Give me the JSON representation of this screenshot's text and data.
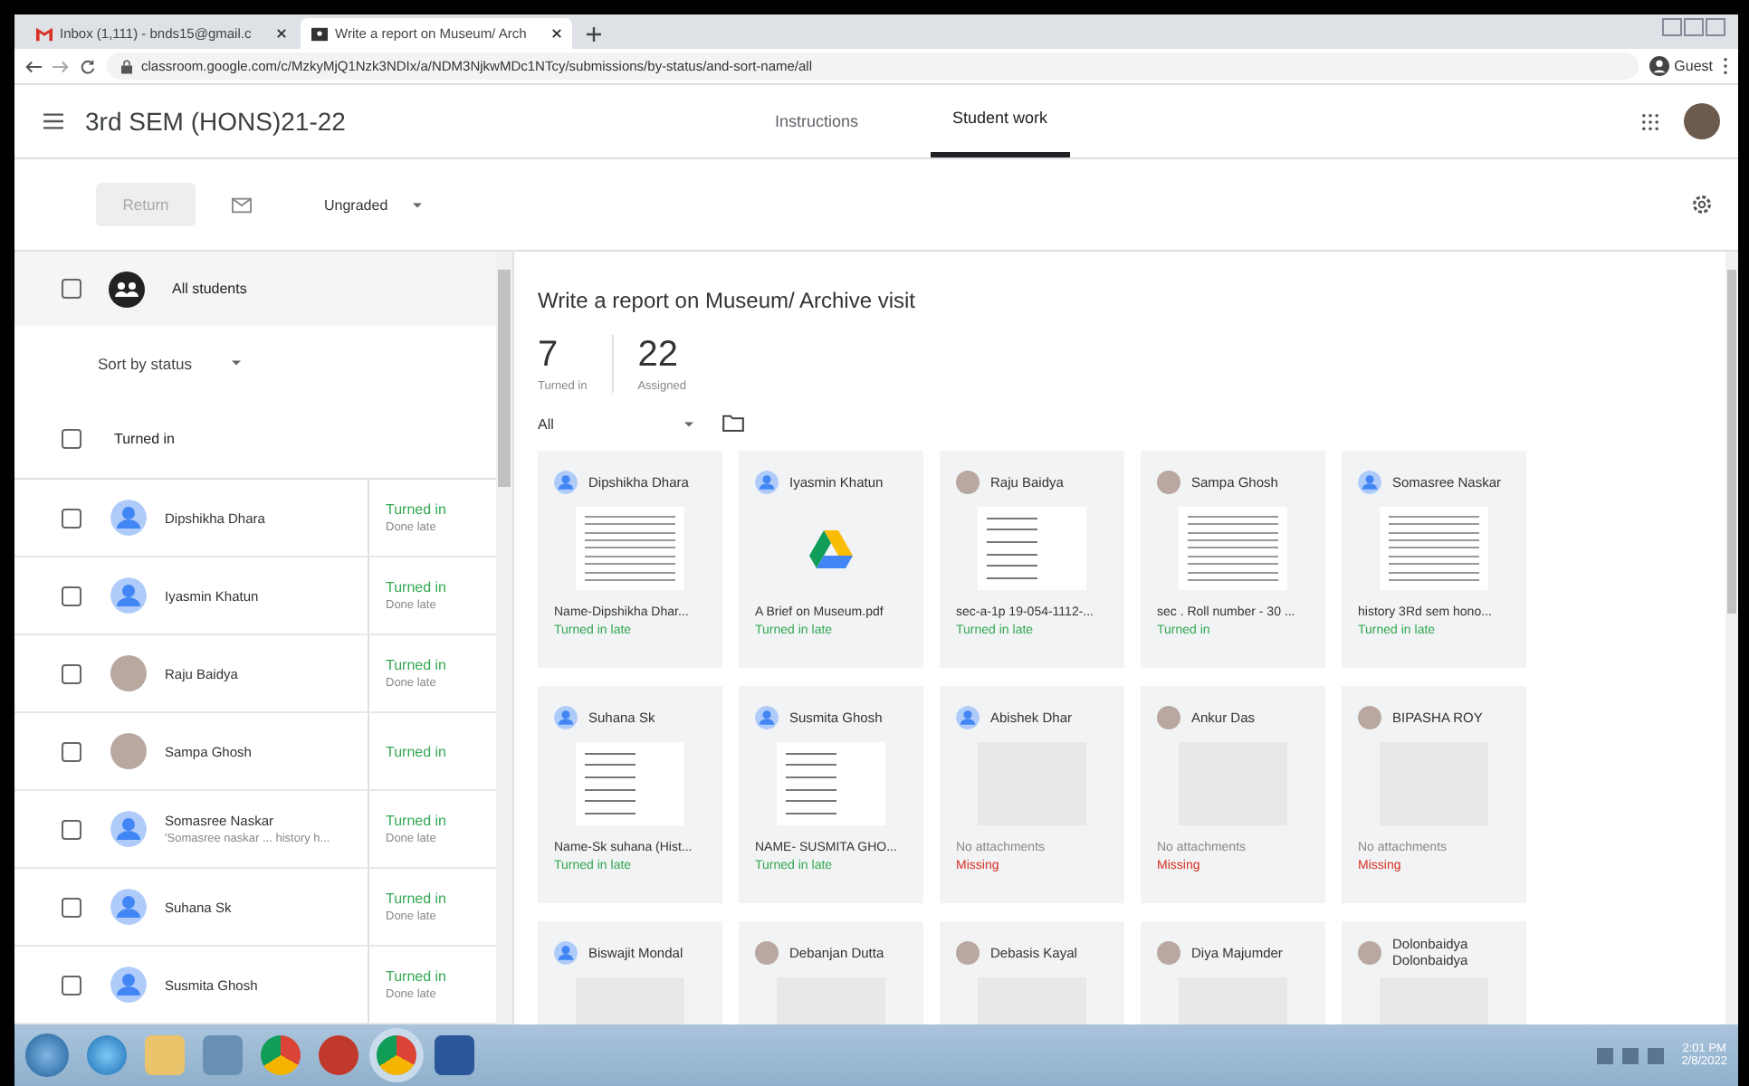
{
  "browser": {
    "tabs": [
      {
        "title": "Inbox (1,111) - bnds15@gmail.c",
        "selected": false
      },
      {
        "title": "Write a report on Museum/ Arch",
        "selected": true
      }
    ],
    "url": "classroom.google.com/c/MzkyMjQ1Nzk3NDIx/a/NDM3NjkwMDc1NTcy/submissions/by-status/and-sort-name/all",
    "profile": "Guest"
  },
  "header": {
    "course_title": "3rd SEM (HONS)21-22",
    "tabs": [
      {
        "label": "Instructions",
        "selected": false
      },
      {
        "label": "Student work",
        "selected": true
      }
    ]
  },
  "toolbar": {
    "return_button": {
      "label": "Return",
      "disabled": true
    },
    "grade_filter": "Ungraded"
  },
  "sidebar": {
    "all_students": {
      "label": "All students",
      "checked": false
    },
    "sort": "Sort by status",
    "group": {
      "label": "Turned in",
      "checked": false
    },
    "students": [
      {
        "name": "Dipshikha Dhara",
        "avatar": {
          "kind": "default"
        },
        "status": "Turned in",
        "note": "Done late",
        "checked": false
      },
      {
        "name": "Iyasmin Khatun",
        "avatar": {
          "kind": "default"
        },
        "status": "Turned in",
        "note": "Done late",
        "checked": false
      },
      {
        "name": "Raju Baidya",
        "avatar": {
          "kind": "photo"
        },
        "status": "Turned in",
        "note": "Done late",
        "checked": false
      },
      {
        "name": "Sampa Ghosh",
        "avatar": {
          "kind": "photo"
        },
        "status": "Turned in",
        "checked": false
      },
      {
        "name": "Somasree Naskar",
        "subtitle": "'Somasree naskar ... history h...",
        "avatar": {
          "kind": "default"
        },
        "status": "Turned in",
        "note": "Done late",
        "checked": false
      },
      {
        "name": "Suhana Sk",
        "avatar": {
          "kind": "default"
        },
        "status": "Turned in",
        "note": "Done late",
        "checked": false
      },
      {
        "name": "Susmita Ghosh",
        "avatar": {
          "kind": "default"
        },
        "status": "Turned in",
        "note": "Done late",
        "checked": false
      }
    ]
  },
  "assignment": {
    "title": "Write a report on Museum/ Archive visit",
    "stats": [
      {
        "value": "7",
        "label": "Turned in"
      },
      {
        "value": "22",
        "label": "Assigned"
      }
    ],
    "filter": "All",
    "cards": [
      {
        "name": "Dipshikha Dhara",
        "avatar": {
          "kind": "default"
        },
        "thumbnail": {
          "kind": "handwriting"
        },
        "file": "Name-Dipshikha Dhar...",
        "status": "Turned in late",
        "kind": "done"
      },
      {
        "name": "Iyasmin Khatun",
        "avatar": {
          "kind": "default"
        },
        "thumbnail": {
          "kind": "drive"
        },
        "file": "A Brief on Museum.pdf",
        "status": "Turned in late",
        "kind": "done"
      },
      {
        "name": "Raju Baidya",
        "avatar": {
          "kind": "photo"
        },
        "thumbnail": {
          "kind": "typed"
        },
        "file": "sec-a-1p 19-054-1112-...",
        "status": "Turned in late",
        "kind": "done"
      },
      {
        "name": "Sampa Ghosh",
        "avatar": {
          "kind": "photo"
        },
        "thumbnail": {
          "kind": "handwriting"
        },
        "file": "sec . Roll number - 30 ...",
        "status": "Turned in",
        "kind": "done"
      },
      {
        "name": "Somasree Naskar",
        "avatar": {
          "kind": "default"
        },
        "thumbnail": {
          "kind": "handwriting"
        },
        "file": "history 3Rd sem hono...",
        "status": "Turned in late",
        "kind": "done"
      },
      {
        "name": "Suhana Sk",
        "avatar": {
          "kind": "default"
        },
        "thumbnail": {
          "kind": "typed"
        },
        "file": "Name-Sk suhana (Hist...",
        "status": "Turned in late",
        "kind": "done"
      },
      {
        "name": "Susmita Ghosh",
        "avatar": {
          "kind": "default"
        },
        "thumbnail": {
          "kind": "typed"
        },
        "file": "NAME- SUSMITA GHO...",
        "status": "Turned in late",
        "kind": "done"
      },
      {
        "name": "Abishek Dhar",
        "avatar": {
          "kind": "default"
        },
        "thumbnail": {
          "kind": "empty"
        },
        "file": "No attachments",
        "status": "Missing",
        "kind": "missing"
      },
      {
        "name": "Ankur Das",
        "avatar": {
          "kind": "photo"
        },
        "thumbnail": {
          "kind": "empty"
        },
        "file": "No attachments",
        "status": "Missing",
        "kind": "missing"
      },
      {
        "name": "BIPASHA ROY",
        "avatar": {
          "kind": "photo"
        },
        "thumbnail": {
          "kind": "empty"
        },
        "file": "No attachments",
        "status": "Missing",
        "kind": "missing"
      },
      {
        "name": "Biswajit Mondal",
        "avatar": {
          "kind": "default"
        },
        "thumbnail": {
          "kind": "empty"
        }
      },
      {
        "name": "Debanjan Dutta",
        "avatar": {
          "kind": "photo"
        },
        "thumbnail": {
          "kind": "empty"
        }
      },
      {
        "name": "Debasis Kayal",
        "avatar": {
          "kind": "photo"
        },
        "thumbnail": {
          "kind": "empty"
        }
      },
      {
        "name": "Diya Majumder",
        "avatar": {
          "kind": "photo"
        },
        "thumbnail": {
          "kind": "empty"
        }
      },
      {
        "name": "Dolonbaidya Dolonbaidya",
        "avatar": {
          "kind": "photo"
        },
        "thumbnail": {
          "kind": "empty"
        }
      }
    ]
  },
  "taskbar": {
    "time": "2:01 PM",
    "date": "2/8/2022"
  }
}
